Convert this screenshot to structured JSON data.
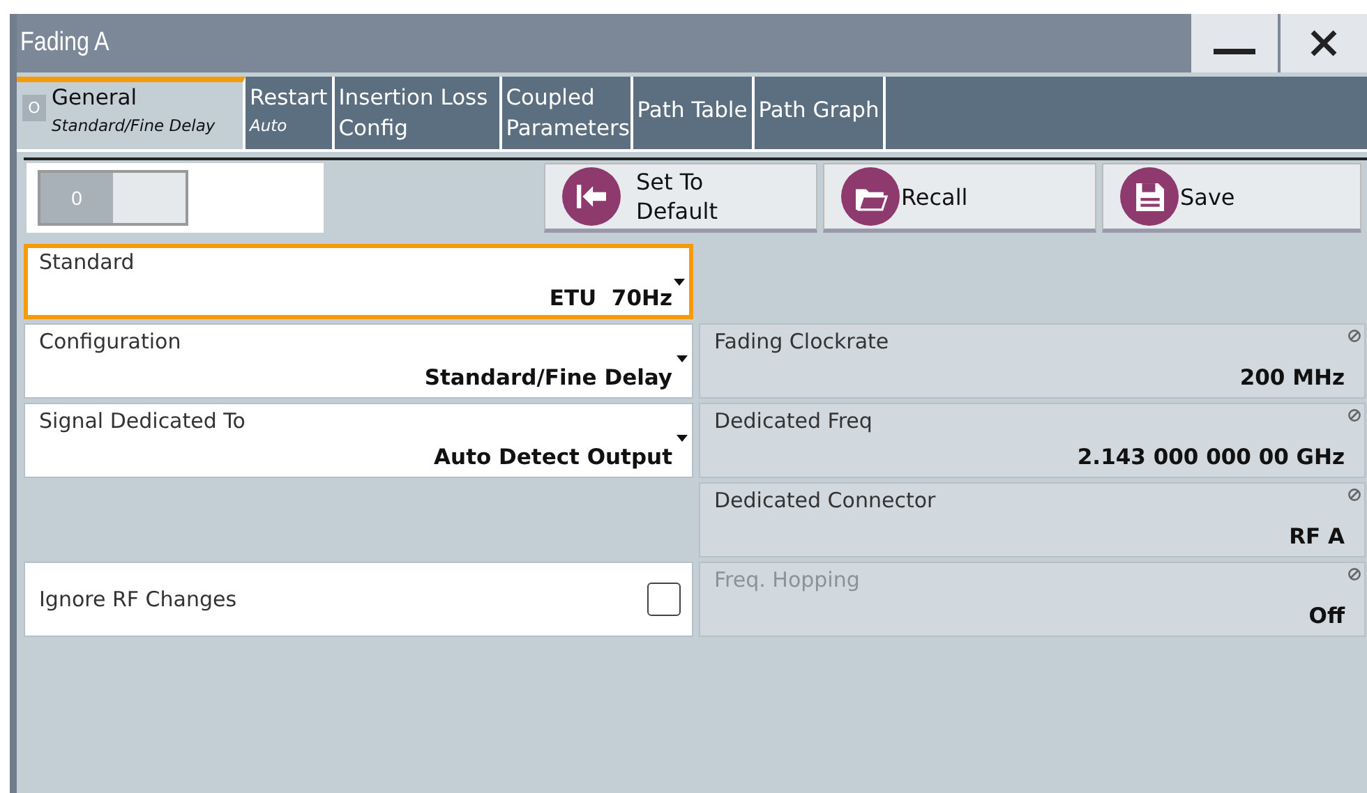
{
  "window": {
    "title": "Fading A",
    "controls": [
      {
        "kind": "minimize"
      },
      {
        "kind": "close"
      }
    ]
  },
  "tabs": [
    {
      "label": "General",
      "sublabel": "Standard/Fine Delay",
      "indicator": "O",
      "selected": true
    },
    {
      "label": "Restart",
      "sublabel": "Auto",
      "selected": false
    },
    {
      "label": "Insertion Loss Config",
      "selected": false
    },
    {
      "label": "Coupled Parameters",
      "selected": false
    },
    {
      "label": "Path Table",
      "selected": false
    },
    {
      "label": "Path Graph",
      "selected": false
    }
  ],
  "toolbar": {
    "toggle": {
      "label": "0",
      "on": false
    },
    "buttons": [
      {
        "label": "Set To Default",
        "kind": "default"
      },
      {
        "label": "Recall",
        "kind": "recall"
      },
      {
        "label": "Save",
        "kind": "save"
      }
    ]
  },
  "left_fields": [
    {
      "kind": "dropdown",
      "label": "Standard",
      "value": "ETU  70Hz",
      "focused": true
    },
    {
      "kind": "dropdown",
      "label": "Configuration",
      "value": "Standard/Fine Delay",
      "focused": false
    },
    {
      "kind": "dropdown",
      "label": "Signal Dedicated To",
      "value": "Auto Detect Output",
      "focused": false
    },
    {
      "kind": "empty"
    },
    {
      "kind": "checkbox",
      "label": "Ignore RF Changes",
      "checked": false,
      "focused": false
    }
  ],
  "right_fields": [
    {
      "kind": "empty"
    },
    {
      "kind": "readonly",
      "label": "Fading Clockrate",
      "value": "200 MHz",
      "disabled": false
    },
    {
      "kind": "readonly",
      "label": "Dedicated Freq",
      "value": "2.143 000 000 00 GHz",
      "disabled": false
    },
    {
      "kind": "readonly",
      "label": "Dedicated Connector",
      "value": "RF A",
      "disabled": false
    },
    {
      "kind": "readonly",
      "label": "Freq. Hopping",
      "value": "Off",
      "disabled": true
    }
  ]
}
